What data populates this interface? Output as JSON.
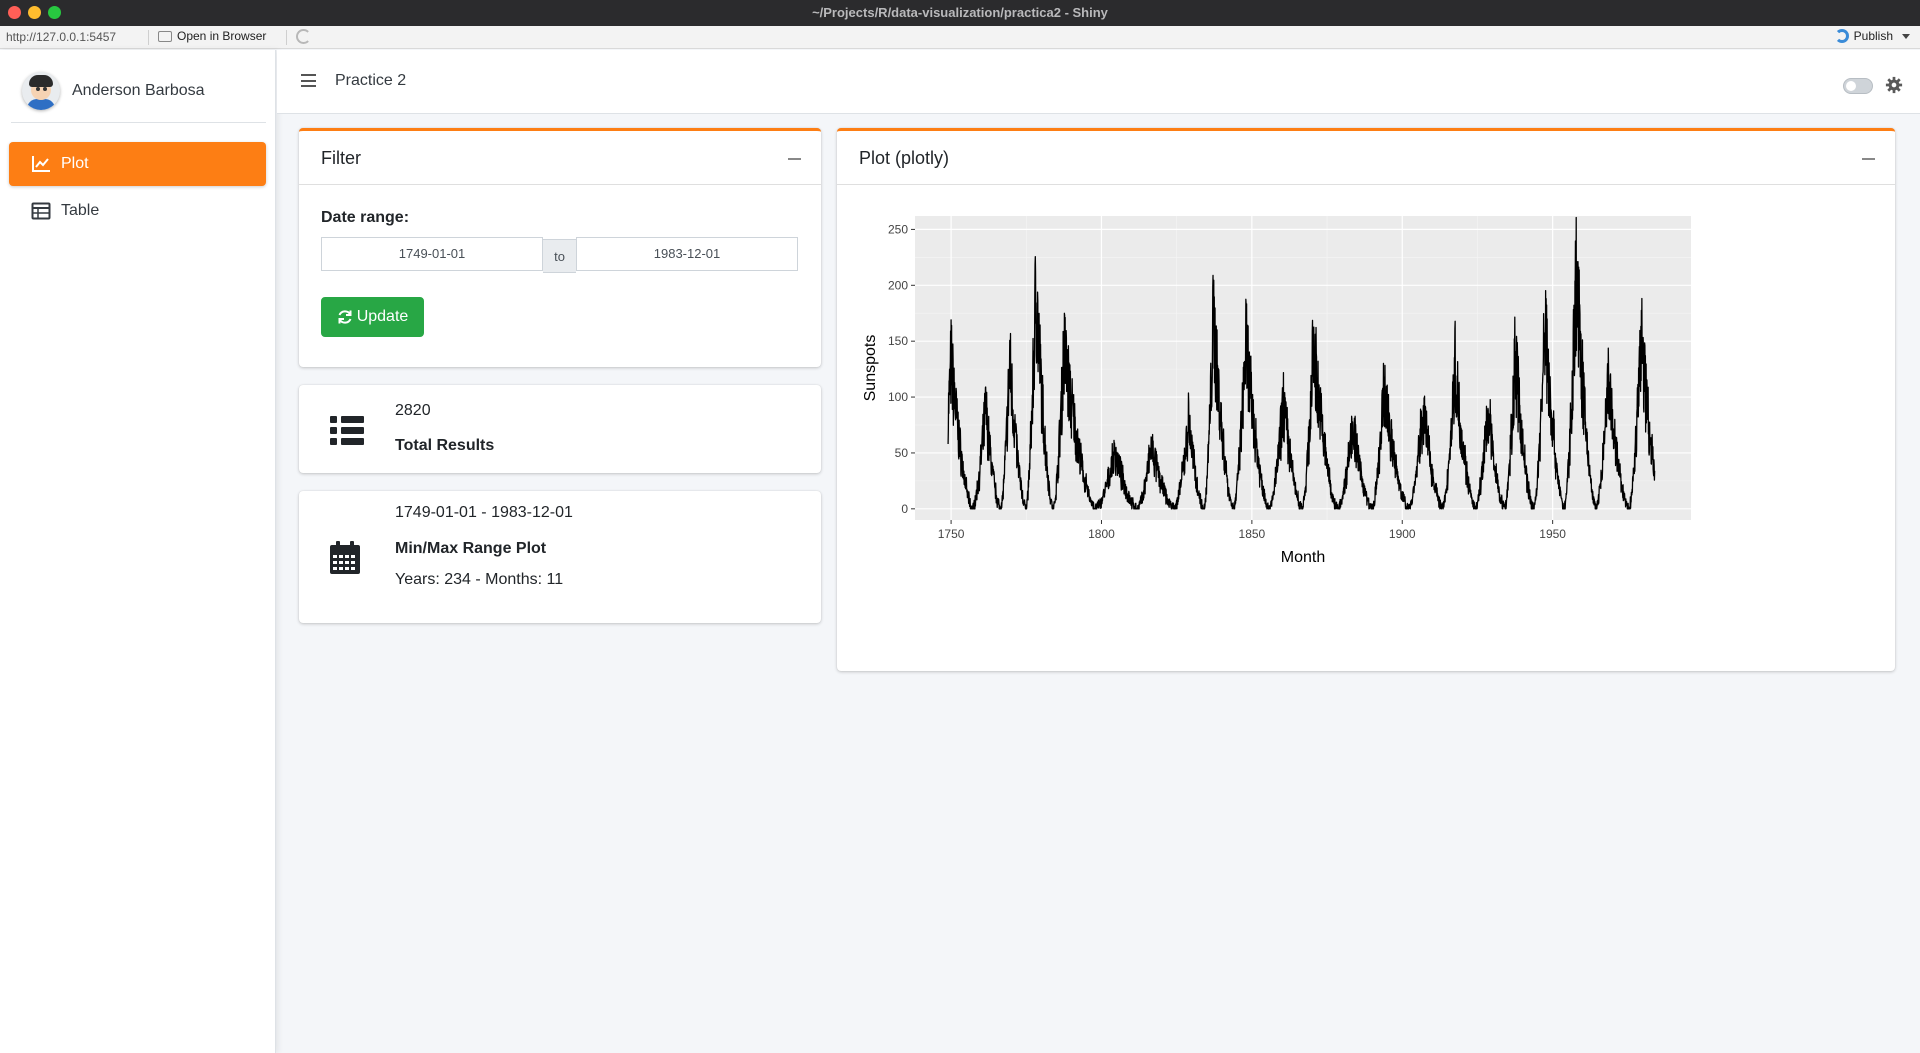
{
  "window": {
    "title": "~/Projects/R/data-visualization/practica2 - Shiny"
  },
  "viewer": {
    "url": "http://127.0.0.1:5457",
    "open_in_browser": "Open in Browser",
    "publish": "Publish"
  },
  "sidebar": {
    "user_name": "Anderson Barbosa",
    "items": [
      {
        "label": "Plot",
        "active": true
      },
      {
        "label": "Table",
        "active": false
      }
    ]
  },
  "header": {
    "title": "Practice 2"
  },
  "filter": {
    "title": "Filter",
    "date_label": "Date range:",
    "start_date": "1749-01-01",
    "sep": "to",
    "end_date": "1983-12-01",
    "update_label": "Update"
  },
  "total_box": {
    "value": "2820",
    "label": "Total Results"
  },
  "range_box": {
    "range": "1749-01-01 - 1983-12-01",
    "label": "Min/Max Range Plot",
    "detail": "Years: 234 - Months: 11"
  },
  "plot_card": {
    "title": "Plot (plotly)"
  },
  "colors": {
    "accent": "#fd7e14",
    "success": "#28a745",
    "plot_bg": "#ebebeb"
  },
  "chart_data": {
    "type": "line",
    "title": "",
    "xlabel": "Month",
    "ylabel": "Sunspots",
    "xlim": [
      1738,
      1996
    ],
    "ylim": [
      -10,
      262
    ],
    "x_ticks": [
      1750,
      1800,
      1850,
      1900,
      1950
    ],
    "y_ticks": [
      0,
      50,
      100,
      150,
      200,
      250
    ],
    "grid": true,
    "series_color": "#000000",
    "cycles": [
      {
        "peak_year": 1750.0,
        "peak": 158
      },
      {
        "peak_year": 1761.5,
        "peak": 108
      },
      {
        "peak_year": 1769.5,
        "peak": 158
      },
      {
        "peak_year": 1778.2,
        "peak": 238
      },
      {
        "peak_year": 1787.5,
        "peak": 174
      },
      {
        "peak_year": 1804.5,
        "peak": 62
      },
      {
        "peak_year": 1816.5,
        "peak": 68
      },
      {
        "peak_year": 1829.0,
        "peak": 96
      },
      {
        "peak_year": 1837.2,
        "peak": 206
      },
      {
        "peak_year": 1848.0,
        "peak": 180
      },
      {
        "peak_year": 1860.5,
        "peak": 116
      },
      {
        "peak_year": 1870.5,
        "peak": 176
      },
      {
        "peak_year": 1883.5,
        "peak": 92
      },
      {
        "peak_year": 1894.0,
        "peak": 130
      },
      {
        "peak_year": 1907.0,
        "peak": 108
      },
      {
        "peak_year": 1917.5,
        "peak": 154
      },
      {
        "peak_year": 1928.5,
        "peak": 108
      },
      {
        "peak_year": 1937.5,
        "peak": 165
      },
      {
        "peak_year": 1947.5,
        "peak": 201
      },
      {
        "peak_year": 1957.8,
        "peak": 253
      },
      {
        "peak_year": 1968.5,
        "peak": 136
      },
      {
        "peak_year": 1979.5,
        "peak": 188
      }
    ],
    "x_start": 1749.0,
    "x_end": 1983.92,
    "first_value": 58,
    "last_value": 34
  }
}
